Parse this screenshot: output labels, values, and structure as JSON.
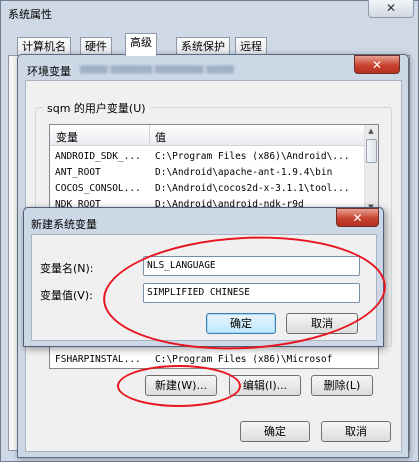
{
  "system_properties": {
    "title": "系统属性",
    "close": "✕",
    "tabs": [
      "计算机名",
      "硬件",
      "高级",
      "系统保护",
      "远程"
    ],
    "ok": "确定",
    "cancel": "取消"
  },
  "env_vars": {
    "title": "环境变量",
    "close": "✕",
    "user_group_label": "sqm 的用户变量(U)",
    "columns": [
      "变量",
      "值"
    ],
    "rows": [
      {
        "name": "ANDROID_SDK_...",
        "value": "C:\\Program Files (x86)\\Android\\..."
      },
      {
        "name": "ANT_ROOT",
        "value": "D:\\Android\\apache-ant-1.9.4\\bin"
      },
      {
        "name": "COCOS_CONSOL...",
        "value": "D:\\Android\\cocos2d-x-3.1.1\\tool..."
      },
      {
        "name": "NDK_ROOT",
        "value": "D:\\Android\\android-ndk-r9d"
      }
    ],
    "system_rows": [
      {
        "name": "FSHARPINSTAL...",
        "value": "C:\\Program Files (x86)\\Microsof"
      }
    ],
    "new_button": "新建(W)...",
    "edit_button": "编辑(I)...",
    "delete_button": "删除(L)"
  },
  "new_var_dialog": {
    "title": "新建系统变量",
    "close": "✕",
    "name_label": "变量名(N):",
    "value_label": "变量值(V):",
    "name_value": "NLS_LANGUAGE",
    "value_value": "SIMPLIFIED CHINESE",
    "ok": "确定",
    "cancel": "取消"
  },
  "colors": {
    "annotation": "#e8141e"
  }
}
